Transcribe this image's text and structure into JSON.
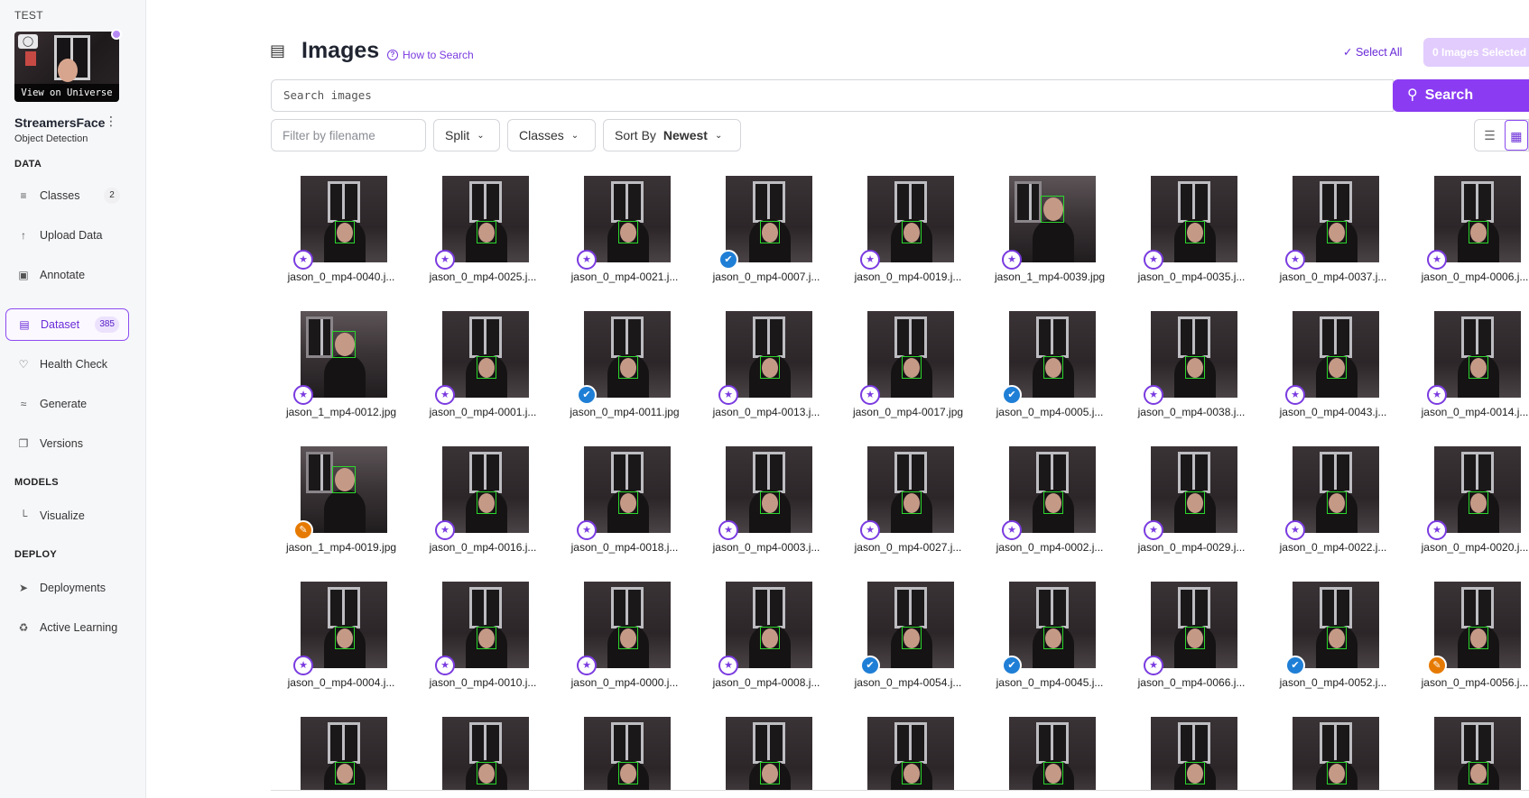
{
  "workspace": "TEST",
  "project": {
    "view_on_universe": "View on Universe",
    "name": "StreamersFace",
    "type": "Object Detection",
    "menu_icon": "kebab-menu-icon"
  },
  "sidebar": {
    "sections": {
      "data": "DATA",
      "models": "MODELS",
      "deploy": "DEPLOY"
    },
    "items": [
      {
        "label": "Classes",
        "icon": "list-icon",
        "badge": "2"
      },
      {
        "label": "Upload Data",
        "icon": "upload-icon"
      },
      {
        "label": "Annotate",
        "icon": "annotate-icon"
      },
      {
        "label": "Dataset",
        "icon": "images-icon",
        "badge": "385",
        "active": true
      },
      {
        "label": "Health Check",
        "icon": "heart-icon"
      },
      {
        "label": "Generate",
        "icon": "layers-icon"
      },
      {
        "label": "Versions",
        "icon": "versions-icon"
      },
      {
        "label": "Visualize",
        "icon": "chart-icon"
      },
      {
        "label": "Deployments",
        "icon": "rocket-icon"
      },
      {
        "label": "Active Learning",
        "icon": "recycle-icon"
      }
    ]
  },
  "header": {
    "title": "Images",
    "how_to_search": "How to Search",
    "select_all": "Select All",
    "selected_button": "0 Images Selected"
  },
  "search": {
    "placeholder": "Search images",
    "button": "Search"
  },
  "filters": {
    "filename_placeholder": "Filter by filename",
    "split": "Split",
    "classes": "Classes",
    "sort_by": "Sort By",
    "sort_value": "Newest"
  },
  "colors": {
    "accent": "#8b3cf2",
    "annotated_badge": "#1f7fd6",
    "edit_badge": "#e67a00",
    "bbox": "#2bd62b"
  },
  "images": [
    {
      "name": "jason_0_mp4-0040.j...",
      "status": "unannotated"
    },
    {
      "name": "jason_0_mp4-0025.j...",
      "status": "unannotated"
    },
    {
      "name": "jason_0_mp4-0021.j...",
      "status": "unannotated"
    },
    {
      "name": "jason_0_mp4-0007.j...",
      "status": "annotated"
    },
    {
      "name": "jason_0_mp4-0019.j...",
      "status": "unannotated"
    },
    {
      "name": "jason_1_mp4-0039.jpg",
      "status": "unannotated"
    },
    {
      "name": "jason_0_mp4-0035.j...",
      "status": "unannotated"
    },
    {
      "name": "jason_0_mp4-0037.j...",
      "status": "unannotated"
    },
    {
      "name": "jason_0_mp4-0006.j...",
      "status": "unannotated"
    },
    {
      "name": "jason_1_mp4-0012.jpg",
      "status": "unannotated"
    },
    {
      "name": "jason_0_mp4-0001.j...",
      "status": "unannotated"
    },
    {
      "name": "jason_0_mp4-0011.jpg",
      "status": "annotated"
    },
    {
      "name": "jason_0_mp4-0013.j...",
      "status": "unannotated"
    },
    {
      "name": "jason_0_mp4-0017.jpg",
      "status": "unannotated"
    },
    {
      "name": "jason_0_mp4-0005.j...",
      "status": "annotated"
    },
    {
      "name": "jason_0_mp4-0038.j...",
      "status": "unannotated"
    },
    {
      "name": "jason_0_mp4-0043.j...",
      "status": "unannotated"
    },
    {
      "name": "jason_0_mp4-0014.j...",
      "status": "unannotated"
    },
    {
      "name": "jason_1_mp4-0019.jpg",
      "status": "edit"
    },
    {
      "name": "jason_0_mp4-0016.j...",
      "status": "unannotated"
    },
    {
      "name": "jason_0_mp4-0018.j...",
      "status": "unannotated"
    },
    {
      "name": "jason_0_mp4-0003.j...",
      "status": "unannotated"
    },
    {
      "name": "jason_0_mp4-0027.j...",
      "status": "unannotated"
    },
    {
      "name": "jason_0_mp4-0002.j...",
      "status": "unannotated"
    },
    {
      "name": "jason_0_mp4-0029.j...",
      "status": "unannotated"
    },
    {
      "name": "jason_0_mp4-0022.j...",
      "status": "unannotated"
    },
    {
      "name": "jason_0_mp4-0020.j...",
      "status": "unannotated"
    },
    {
      "name": "jason_0_mp4-0004.j...",
      "status": "unannotated"
    },
    {
      "name": "jason_0_mp4-0010.j...",
      "status": "unannotated"
    },
    {
      "name": "jason_0_mp4-0000.j...",
      "status": "unannotated"
    },
    {
      "name": "jason_0_mp4-0008.j...",
      "status": "unannotated"
    },
    {
      "name": "jason_0_mp4-0054.j...",
      "status": "annotated"
    },
    {
      "name": "jason_0_mp4-0045.j...",
      "status": "annotated"
    },
    {
      "name": "jason_0_mp4-0066.j...",
      "status": "unannotated"
    },
    {
      "name": "jason_0_mp4-0052.j...",
      "status": "annotated"
    },
    {
      "name": "jason_0_mp4-0056.j...",
      "status": "edit"
    },
    {
      "name": "",
      "status": "none"
    },
    {
      "name": "",
      "status": "none"
    },
    {
      "name": "",
      "status": "none"
    },
    {
      "name": "",
      "status": "none"
    },
    {
      "name": "",
      "status": "none"
    },
    {
      "name": "",
      "status": "none"
    },
    {
      "name": "",
      "status": "none"
    },
    {
      "name": "",
      "status": "none"
    },
    {
      "name": "",
      "status": "none"
    }
  ]
}
